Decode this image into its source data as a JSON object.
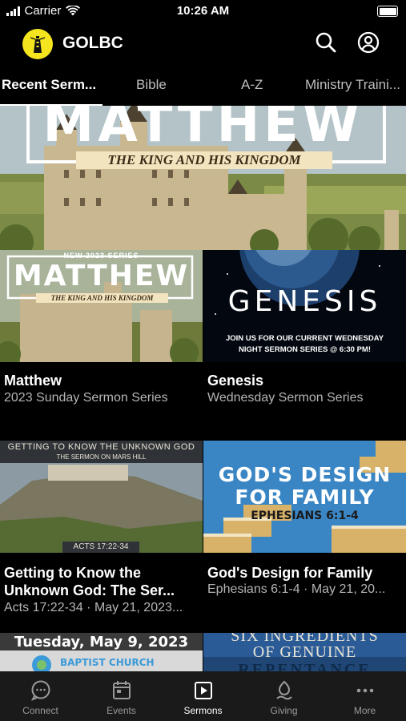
{
  "status_bar": {
    "carrier": "Carrier",
    "time": "10:26 AM"
  },
  "header": {
    "app_name": "GOLBC"
  },
  "tabs": [
    {
      "label": "Recent Serm..."
    },
    {
      "label": "Bible"
    },
    {
      "label": "A-Z"
    },
    {
      "label": "Ministry Traini..."
    }
  ],
  "hero": {
    "heading": "MATTHEW",
    "subheading": "THE KING AND HIS KINGDOM"
  },
  "cards": [
    {
      "title": "Matthew",
      "subtitle": "2023 Sunday Sermon Series",
      "thumb": {
        "tag": "NEW 2023 SERIES",
        "heading": "MATTHEW",
        "subheading": "THE KING AND HIS KINGDOM"
      }
    },
    {
      "title": "Genesis",
      "subtitle": "Wednesday Sermon Series",
      "thumb": {
        "heading": "GENESIS",
        "line1": "JOIN US FOR OUR CURRENT WEDNESDAY",
        "line2": "NIGHT SERMON SERIES @ 6:30 PM!"
      }
    },
    {
      "title": "Getting to Know the Unknown God: The Ser...",
      "subtitle": "Acts 17:22-34 · May 21, 2023...",
      "thumb": {
        "line1": "GETTING TO KNOW THE UNKNOWN GOD",
        "line2": "THE SERMON ON MARS HILL",
        "ref": "ACTS 17:22-34"
      }
    },
    {
      "title": "God's Design for Family",
      "subtitle": "Ephesians 6:1-4 · May 21, 20...",
      "thumb": {
        "line1": "GOD'S DESIGN",
        "line2": "FOR FAMILY",
        "ref": "EPHESIANS 6:1-4"
      }
    },
    {
      "thumb": {
        "line1": "Tuesday, May 9, 2023",
        "line2": "BAPTIST CHURCH"
      }
    },
    {
      "thumb": {
        "line1": "SIX INGREDIENTS",
        "line2": "OF GENUINE",
        "line3": "REPENTANCE"
      }
    }
  ],
  "tabbar": [
    {
      "label": "Connect",
      "icon": "chat-bubble-icon"
    },
    {
      "label": "Events",
      "icon": "calendar-icon"
    },
    {
      "label": "Sermons",
      "icon": "play-square-icon"
    },
    {
      "label": "Giving",
      "icon": "giving-icon"
    },
    {
      "label": "More",
      "icon": "more-dots-icon"
    }
  ]
}
